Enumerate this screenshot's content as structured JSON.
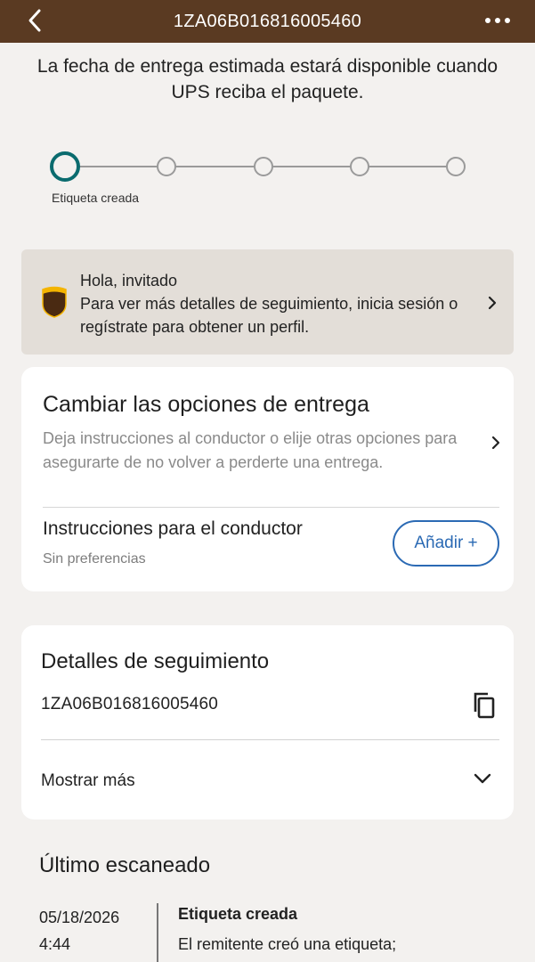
{
  "header": {
    "tracking_number": "1ZA06B016816005460",
    "back_icon": "chevron-left-icon",
    "more_icon": "more-horizontal-icon"
  },
  "estimate_message": "La fecha de entrega estimada estará disponible cuando UPS reciba el paquete.",
  "progress": {
    "current_step_label": "Etiqueta creada",
    "total_steps": 5,
    "current_step": 1,
    "active_color": "#0a6b6e"
  },
  "guest_banner": {
    "greeting": "Hola, invitado",
    "message": "Para ver más detalles de seguimiento, inicia sesión o regístrate para obtener un perfil.",
    "logo_icon": "ups-shield-icon",
    "logo_text": "ups"
  },
  "delivery_options": {
    "title": "Cambiar las opciones de entrega",
    "description": "Deja instrucciones al conductor o elije otras opciones para asegurarte de no volver a perderte una entrega.",
    "driver_instructions_label": "Instrucciones para el conductor",
    "driver_preference": "Sin preferencias",
    "add_button_label": "Añadir +"
  },
  "tracking_details": {
    "title": "Detalles de seguimiento",
    "number": "1ZA06B016816005460",
    "copy_icon": "copy-icon",
    "show_more_label": "Mostrar más"
  },
  "last_scan": {
    "title": "Último escaneado",
    "date": "05/18/2026",
    "time": "4:44",
    "event_title": "Etiqueta creada",
    "event_description": "El remitente creó una etiqueta;"
  },
  "colors": {
    "header_bg": "#5a3a22",
    "banner_bg": "#e3ded8",
    "page_bg": "#f3f1ef",
    "link_blue": "#2b6ab4"
  }
}
